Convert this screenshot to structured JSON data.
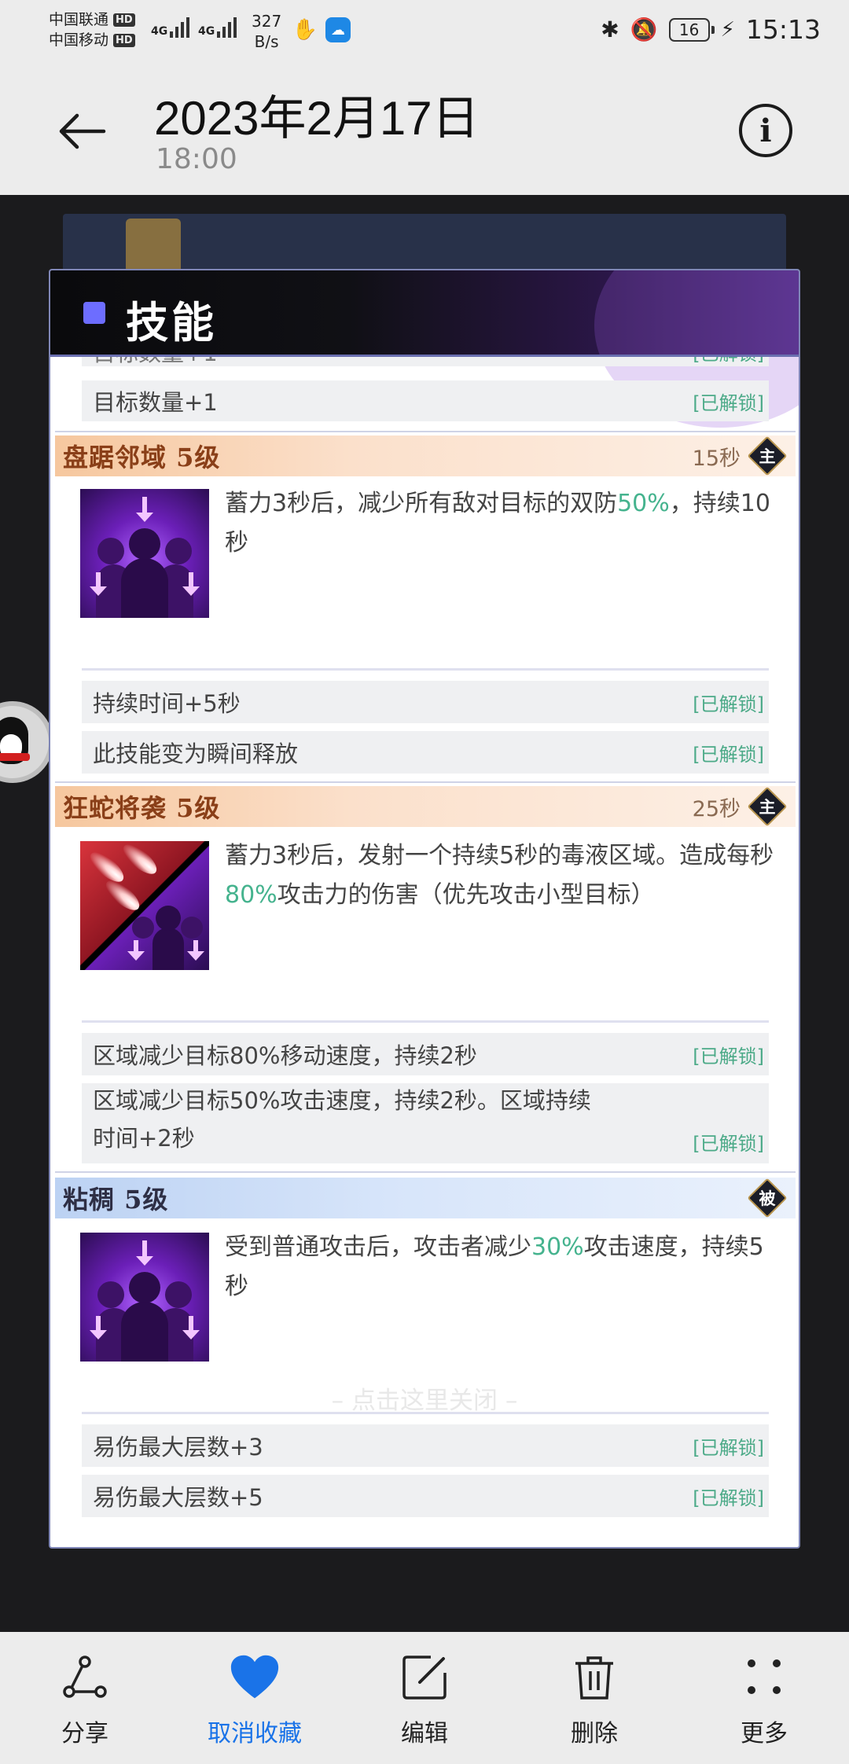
{
  "status_bar": {
    "carrier1": "中国联通",
    "carrier2": "中国移动",
    "hd": "HD",
    "net_type": "4G",
    "speed_value": "327",
    "speed_unit": "B/s",
    "battery": "16",
    "time": "15:13"
  },
  "header": {
    "title": "2023年2月17日",
    "subtitle": "18:00"
  },
  "panel": {
    "title": "技能",
    "top_row": {
      "text": "目标数量+1",
      "status": "[已解锁]"
    },
    "sections": [
      {
        "name": "盘踞邻域 5级",
        "cooldown": "15秒",
        "badge": "主",
        "desc_parts": [
          "蓄力3秒后，减少所有敌对目标的双防",
          "50%",
          "，持续10秒"
        ],
        "upgrades": [
          {
            "text": "持续时间+5秒",
            "status": "[已解锁]"
          },
          {
            "text": "此技能变为瞬间释放",
            "status": "[已解锁]"
          }
        ]
      },
      {
        "name": "狂蛇将袭 5级",
        "cooldown": "25秒",
        "badge": "主",
        "desc_parts": [
          "蓄力3秒后，发射一个持续5秒的毒液区域。造成每秒",
          "80%",
          "攻击力的伤害（优先攻击小型目标）"
        ],
        "upgrades": [
          {
            "text": "区域减少目标80%移动速度，持续2秒",
            "status": "[已解锁]"
          },
          {
            "text_line1": "区域减少目标50%攻击速度，持续2秒。区域持续",
            "text_line2": "时间+2秒",
            "status": "[已解锁]"
          }
        ]
      },
      {
        "name": "粘稠 5级",
        "badge": "被",
        "desc_parts": [
          "受到普通攻击后，攻击者减少",
          "30%",
          "攻击速度，持续5秒"
        ],
        "upgrades": [
          {
            "text": "易伤最大层数+3",
            "status": "[已解锁]"
          },
          {
            "text": "易伤最大层数+5",
            "status": "[已解锁]"
          }
        ]
      }
    ]
  },
  "close_hint": "– 点击这里关闭 –",
  "toolbar": {
    "items": [
      {
        "label": "分享",
        "icon": "share-icon"
      },
      {
        "label": "取消收藏",
        "icon": "heart-icon"
      },
      {
        "label": "编辑",
        "icon": "edit-icon"
      },
      {
        "label": "删除",
        "icon": "trash-icon"
      },
      {
        "label": "更多",
        "icon": "more-icon"
      }
    ]
  },
  "colors": {
    "accent_blue": "#1a73e8",
    "highlight_green": "#45b38e",
    "unlocked_green": "#4caa88"
  }
}
